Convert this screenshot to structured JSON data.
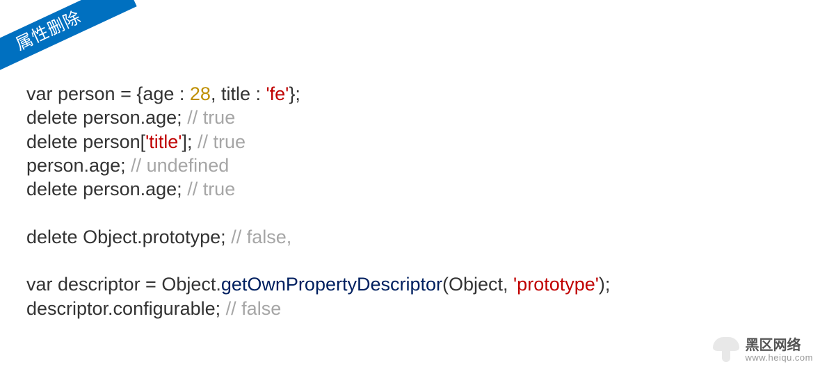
{
  "ribbon": "属性删除",
  "code": {
    "l1a": "var person = {age : ",
    "l1b": "28",
    "l1c": ", title : ",
    "l1d": "'fe'",
    "l1e": "};",
    "l2a": "delete person.age; ",
    "l2b": "// true",
    "l3a": "delete person[",
    "l3b": "'title'",
    "l3c": "]; ",
    "l3d": "// true",
    "l4a": "person.age; ",
    "l4b": "// undefined",
    "l5a": "delete person.age; ",
    "l5b": "// true",
    "l6a": "delete Object.prototype; ",
    "l6b": "// false,",
    "l7a": "var descriptor = Object.",
    "l7b": "getOwnPropertyDescriptor",
    "l7c": "(Object, ",
    "l7d": "'prototype'",
    "l7e": ");",
    "l8a": "descriptor.configurable; ",
    "l8b": "// false"
  },
  "watermark": {
    "cn": "黑区网络",
    "en": "www.heiqu.com"
  }
}
